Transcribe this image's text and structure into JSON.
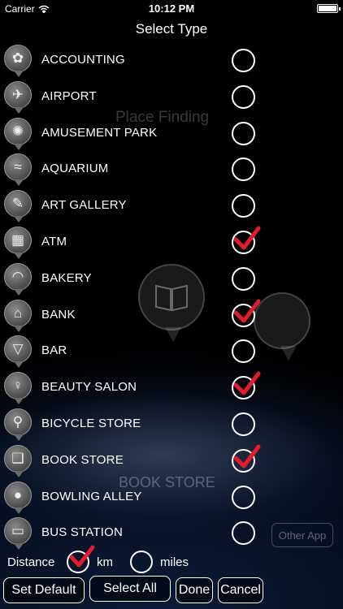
{
  "status_bar": {
    "carrier": "Carrier",
    "time": "10:12 PM"
  },
  "title": "Select Type",
  "background": {
    "brand_text": "Place Finding",
    "selected_text": "BOOK STORE",
    "other_app": "Other App"
  },
  "items": [
    {
      "label": "ACCOUNTING",
      "icon": "accounting-icon",
      "glyph": "✿",
      "checked": false
    },
    {
      "label": "AIRPORT",
      "icon": "airplane-icon",
      "glyph": "✈",
      "checked": false
    },
    {
      "label": "AMUSEMENT PARK",
      "icon": "ferris-wheel-icon",
      "glyph": "✺",
      "checked": false
    },
    {
      "label": "AQUARIUM",
      "icon": "shark-icon",
      "glyph": "≈",
      "checked": false
    },
    {
      "label": "ART GALLERY",
      "icon": "paintbrush-icon",
      "glyph": "✎",
      "checked": false
    },
    {
      "label": "ATM",
      "icon": "atm-icon",
      "glyph": "▦",
      "checked": true
    },
    {
      "label": "BAKERY",
      "icon": "bread-icon",
      "glyph": "◠",
      "checked": false
    },
    {
      "label": "BANK",
      "icon": "bank-icon",
      "glyph": "⌂",
      "checked": true
    },
    {
      "label": "BAR",
      "icon": "cocktail-icon",
      "glyph": "▽",
      "checked": false
    },
    {
      "label": "BEAUTY SALON",
      "icon": "salon-icon",
      "glyph": "♀",
      "checked": true
    },
    {
      "label": "BICYCLE STORE",
      "icon": "bicycle-icon",
      "glyph": "⚲",
      "checked": false
    },
    {
      "label": "BOOK STORE",
      "icon": "book-icon",
      "glyph": "❑",
      "checked": true
    },
    {
      "label": "BOWLING ALLEY",
      "icon": "bowling-icon",
      "glyph": "●",
      "checked": false
    },
    {
      "label": "BUS STATION",
      "icon": "bus-icon",
      "glyph": "▭",
      "checked": false
    }
  ],
  "distance": {
    "label": "Distance",
    "km": "km",
    "miles": "miles",
    "unit_selected": "km"
  },
  "buttons": {
    "set_default": "Set Default",
    "select_all": "Select All",
    "done": "Done",
    "cancel": "Cancel"
  }
}
